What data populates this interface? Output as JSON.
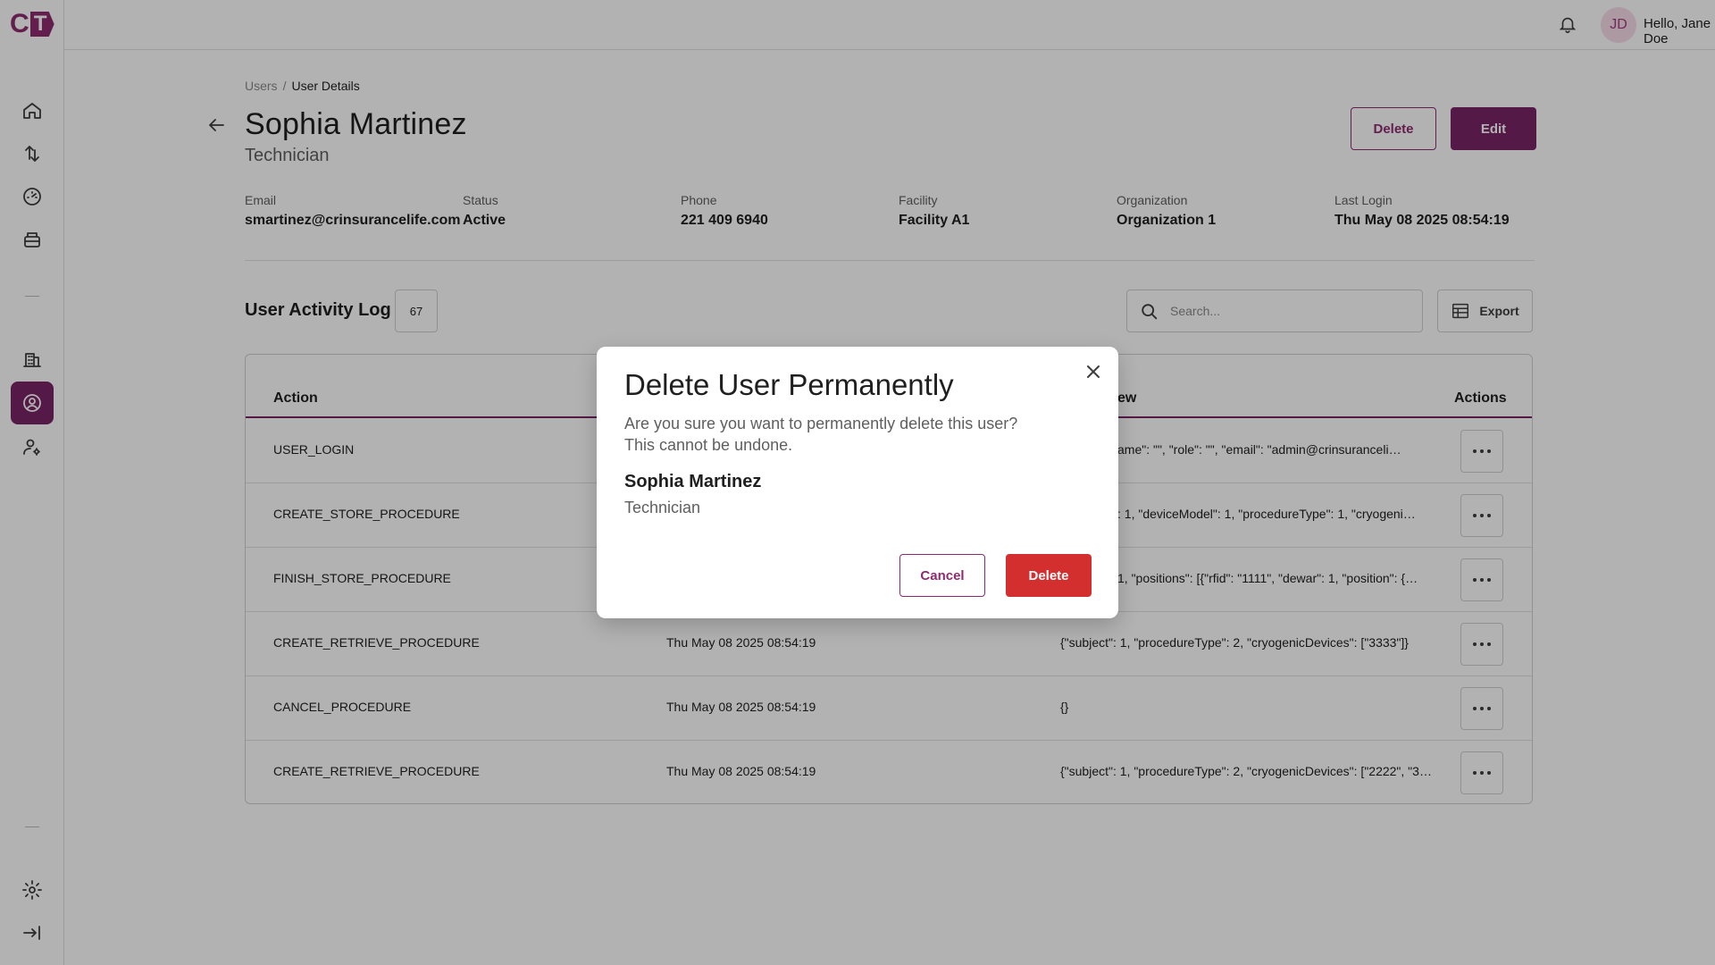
{
  "logo": {
    "c": "C",
    "t": "T"
  },
  "topbar": {
    "avatar_initials": "JD",
    "greeting": "Hello, Jane Doe"
  },
  "breadcrumb": {
    "parent": "Users",
    "separator": "/",
    "current": "User Details"
  },
  "user": {
    "name": "Sophia Martinez",
    "role": "Technician",
    "delete_label": "Delete",
    "edit_label": "Edit",
    "fields": [
      {
        "label": "Email",
        "value": "smartinez@crinsurancelife.com"
      },
      {
        "label": "Status",
        "value": "Active"
      },
      {
        "label": "Phone",
        "value": "221 409 6940"
      },
      {
        "label": "Facility",
        "value": "Facility A1"
      },
      {
        "label": "Organization",
        "value": "Organization 1"
      },
      {
        "label": "Last Login",
        "value": "Thu May 08 2025 08:54:19"
      }
    ]
  },
  "activity": {
    "title": "User Activity Log",
    "count": "67",
    "search_placeholder": "Search...",
    "export_label": "Export",
    "columns": {
      "action": "Action",
      "new": "ew",
      "actions": "Actions"
    },
    "rows": [
      {
        "action": "USER_LOGIN",
        "time": "",
        "data": "ame\": \"\", \"role\": \"\", \"email\": \"admin@crinsurancelife.c..."
      },
      {
        "action": "CREATE_STORE_PROCEDURE",
        "time": "",
        "data": ": 1, \"deviceModel\": 1, \"procedureType\": 1, \"cryogenicDev..."
      },
      {
        "action": "FINISH_STORE_PROCEDURE",
        "time": "",
        "data": "1, \"positions\": [{\"rfid\": \"1111\", \"dewar\": 1, \"position\": {\"ho..."
      },
      {
        "action": "CREATE_RETRIEVE_PROCEDURE",
        "time": "Thu May 08 2025 08:54:19",
        "data": "{\"subject\": 1, \"procedureType\": 2, \"cryogenicDevices\": [\"3333\"]}"
      },
      {
        "action": "CANCEL_PROCEDURE",
        "time": "Thu May 08 2025 08:54:19",
        "data": "{}"
      },
      {
        "action": "CREATE_RETRIEVE_PROCEDURE",
        "time": "Thu May 08 2025 08:54:19",
        "data": "{\"subject\": 1, \"procedureType\": 2, \"cryogenicDevices\": [\"2222\", \"333..."
      }
    ]
  },
  "modal": {
    "title": "Delete User Permanently",
    "message_line1": "Are you sure you want to permanently delete this user?",
    "message_line2": "This cannot be undone.",
    "user_name": "Sophia Martinez",
    "user_role": "Technician",
    "cancel_label": "Cancel",
    "delete_label": "Delete"
  },
  "colors": {
    "brand": "#7a2566",
    "danger": "#d32f2f",
    "overlay": "rgba(0,0,0,0.3)"
  },
  "icons": [
    "home-icon",
    "transfer-icon",
    "dashboard-icon",
    "storage-icon",
    "building-icon",
    "user-circle-icon",
    "user-settings-icon",
    "gear-icon",
    "collapse-icon",
    "bell-icon",
    "chevron-down-icon",
    "arrow-left-icon",
    "search-icon",
    "export-icon",
    "more-icon",
    "close-icon"
  ]
}
